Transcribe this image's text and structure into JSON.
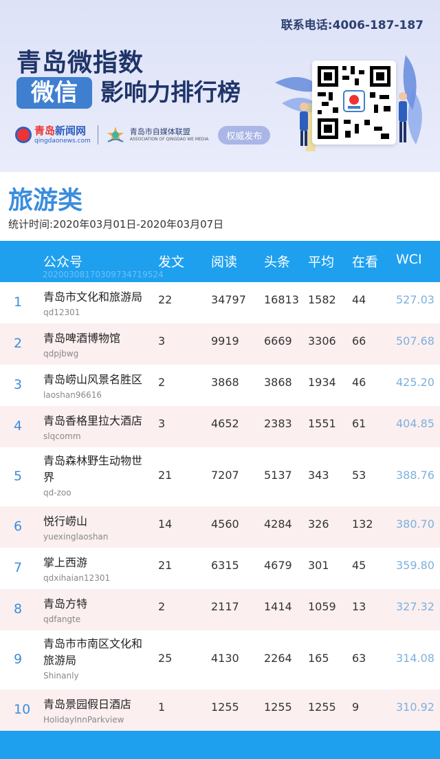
{
  "header": {
    "contact": "联系电话:4006-187-187",
    "title_line1": "青岛微指数",
    "title_badge": "微信",
    "title_line2": "影响力排行榜",
    "logo_qd_name_part1": "青岛",
    "logo_qd_name_part2": "新闻网",
    "logo_qd_url": "qingdaonews.com",
    "logo_alliance_name": "青岛市自媒体联盟",
    "logo_alliance_en": "ASSOCIATION OF QINGDAO WE MEDIA",
    "publish_label": "权威发布"
  },
  "section": {
    "title": "旅游类",
    "period": "统计时间:2020年03月01日-2020年03月07日"
  },
  "table": {
    "headers": {
      "account": "公众号",
      "posts": "发文",
      "reads": "阅读",
      "headline": "头条",
      "average": "平均",
      "likes": "在看",
      "wci": "WCI"
    },
    "watermark": "20200308170309734719524",
    "rows": [
      {
        "rank": "1",
        "name": "青岛市文化和旅游局",
        "account": "qd12301",
        "posts": "22",
        "reads": "34797",
        "headline": "16813",
        "average": "1582",
        "likes": "44",
        "wci": "527.03"
      },
      {
        "rank": "2",
        "name": "青岛啤酒博物馆",
        "account": "qdpjbwg",
        "posts": "3",
        "reads": "9919",
        "headline": "6669",
        "average": "3306",
        "likes": "66",
        "wci": "507.68"
      },
      {
        "rank": "3",
        "name": "青岛崂山风景名胜区",
        "account": "laoshan96616",
        "posts": "2",
        "reads": "3868",
        "headline": "3868",
        "average": "1934",
        "likes": "46",
        "wci": "425.20"
      },
      {
        "rank": "4",
        "name": "青岛香格里拉大酒店",
        "account": "slqcomm",
        "posts": "3",
        "reads": "4652",
        "headline": "2383",
        "average": "1551",
        "likes": "61",
        "wci": "404.85"
      },
      {
        "rank": "5",
        "name": "青岛森林野生动物世界",
        "account": "qd-zoo",
        "posts": "21",
        "reads": "7207",
        "headline": "5137",
        "average": "343",
        "likes": "53",
        "wci": "388.76"
      },
      {
        "rank": "6",
        "name": "悦行崂山",
        "account": "yuexinglaoshan",
        "posts": "14",
        "reads": "4560",
        "headline": "4284",
        "average": "326",
        "likes": "132",
        "wci": "380.70"
      },
      {
        "rank": "7",
        "name": "掌上西游",
        "account": "qdxihaian12301",
        "posts": "21",
        "reads": "6315",
        "headline": "4679",
        "average": "301",
        "likes": "45",
        "wci": "359.80"
      },
      {
        "rank": "8",
        "name": "青岛方特",
        "account": "qdfangte",
        "posts": "2",
        "reads": "2117",
        "headline": "1414",
        "average": "1059",
        "likes": "13",
        "wci": "327.32"
      },
      {
        "rank": "9",
        "name": "青岛市市南区文化和旅游局",
        "account": "Shinanly",
        "posts": "25",
        "reads": "4130",
        "headline": "2264",
        "average": "165",
        "likes": "63",
        "wci": "314.08"
      },
      {
        "rank": "10",
        "name": "青岛景园假日酒店",
        "account": "HolidayInnParkview",
        "posts": "1",
        "reads": "1255",
        "headline": "1255",
        "average": "1255",
        "likes": "9",
        "wci": "310.92"
      }
    ]
  },
  "colors": {
    "accent": "#1ea0ef",
    "title_blue": "#3b8ddd",
    "row_alt": "#fbeff0",
    "wci_text": "#7eb0dc",
    "banner_bg": "#dde2f7"
  }
}
